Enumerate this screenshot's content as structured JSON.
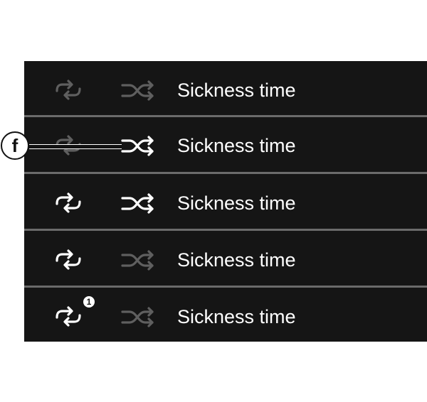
{
  "rows": [
    {
      "label": "Sickness time",
      "repeat_state": "dim",
      "shuffle_state": "dim",
      "badge": ""
    },
    {
      "label": "Sickness time",
      "repeat_state": "dim",
      "shuffle_state": "active",
      "badge": ""
    },
    {
      "label": "Sickness time",
      "repeat_state": "active",
      "shuffle_state": "active",
      "badge": ""
    },
    {
      "label": "Sickness time",
      "repeat_state": "active",
      "shuffle_state": "dim",
      "badge": ""
    },
    {
      "label": "Sickness time",
      "repeat_state": "active",
      "shuffle_state": "dim",
      "badge": "1"
    }
  ],
  "callout": {
    "letter": "f"
  },
  "icons": {
    "repeat": "repeat-icon",
    "shuffle": "shuffle-icon",
    "repeat_one": "repeat-one-icon"
  },
  "colors": {
    "active": "#ffffff",
    "dim": "#5f5f5f",
    "background": "#151515",
    "divider": "#6b6b6b"
  }
}
